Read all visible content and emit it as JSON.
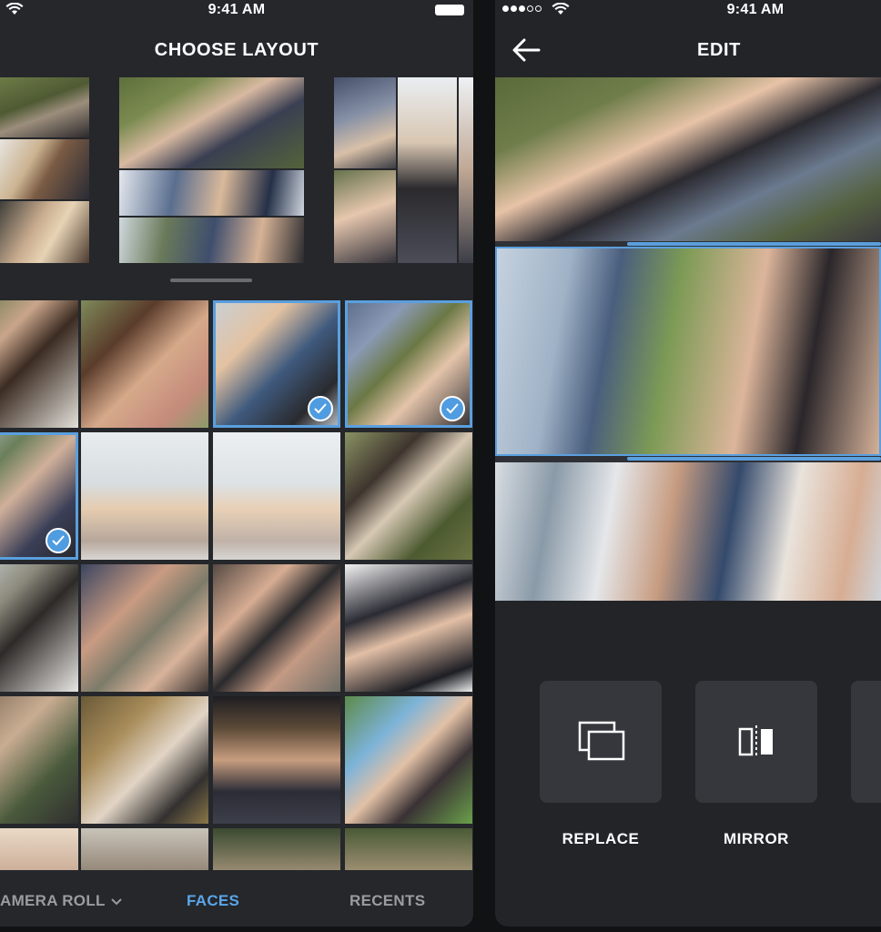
{
  "left_screen": {
    "status_time": "9:41 AM",
    "title": "CHOOSE LAYOUT",
    "tabs": [
      {
        "label": "AMERA ROLL",
        "active": false
      },
      {
        "label": "FACES",
        "active": true
      },
      {
        "label": "RECENTS",
        "active": false
      }
    ],
    "selected_count": 3
  },
  "right_screen": {
    "status_time": "9:41 AM",
    "title": "EDIT",
    "tools": [
      {
        "label": "REPLACE",
        "icon": "replace-icon"
      },
      {
        "label": "MIRROR",
        "icon": "mirror-icon"
      }
    ]
  },
  "colors": {
    "background": "#25272b",
    "accent_blue": "#4f9ce0",
    "active_tab": "#5aa6ea",
    "inactive_tab": "#9a9ca0",
    "tool_button": "#35373c"
  }
}
